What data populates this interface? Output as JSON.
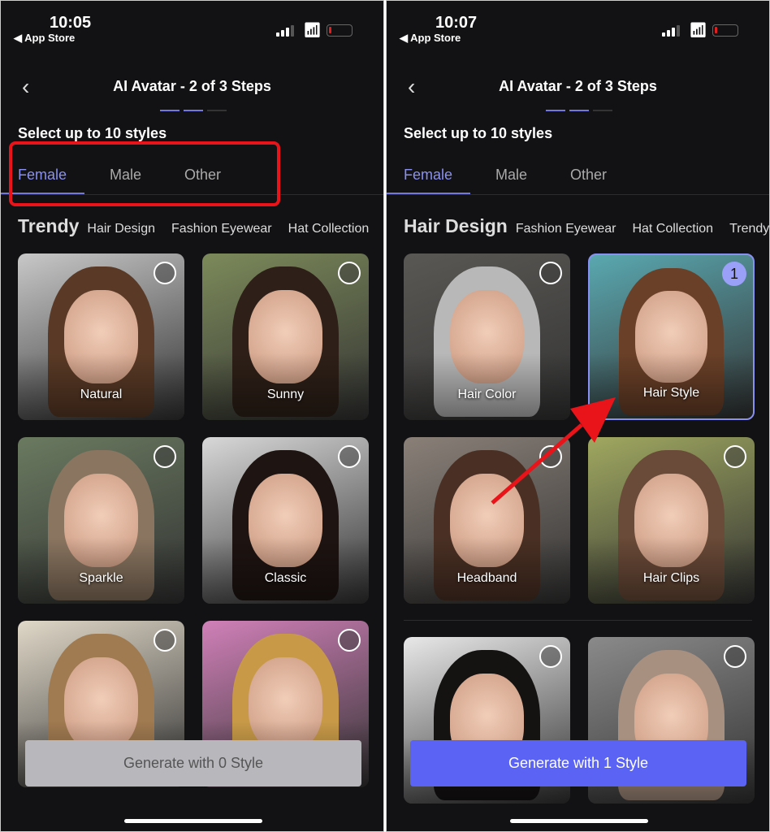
{
  "colors": {
    "accent": "#7378e0",
    "button_active": "#5b63f5",
    "annotation": "#e8141a"
  },
  "screens": [
    {
      "time": "10:05",
      "back_app": "◀ App Store",
      "title": "AI Avatar - 2 of 3 Steps",
      "subtitle": "Select up to 10 styles",
      "tabs": [
        "Female",
        "Male",
        "Other"
      ],
      "active_tab": 0,
      "categories": [
        "Trendy",
        "Hair Design",
        "Fashion Eyewear",
        "Hat Collection"
      ],
      "cards": [
        {
          "label": "Natural",
          "hair": "#5a3a26",
          "bg": "#c8c8c8"
        },
        {
          "label": "Sunny",
          "hair": "#2e2018",
          "bg": "#7c8a5a"
        },
        {
          "label": "Sparkle",
          "hair": "#8a7560",
          "bg": "#6a7a60"
        },
        {
          "label": "Classic",
          "hair": "#1e1412",
          "bg": "#d8d8d8"
        },
        {
          "label": "",
          "hair": "#a07a50",
          "bg": "#e0d8c8"
        },
        {
          "label": "",
          "hair": "#c89a48",
          "bg": "#d080b8"
        }
      ],
      "generate": "Generate with 0 Style",
      "steps_done": 2,
      "steps_total": 3
    },
    {
      "time": "10:07",
      "back_app": "◀ App Store",
      "title": "AI Avatar - 2 of 3 Steps",
      "subtitle": "Select up to 10 styles",
      "tabs": [
        "Female",
        "Male",
        "Other"
      ],
      "active_tab": 0,
      "categories": [
        "Hair Design",
        "Fashion Eyewear",
        "Hat Collection",
        "Trendy"
      ],
      "cards": [
        {
          "label": "Hair Color",
          "hair": "#b8b8b8",
          "bg": "#5a5854"
        },
        {
          "label": "Hair Style",
          "hair": "#6a4028",
          "bg": "#5aa8b0",
          "selected": "1"
        },
        {
          "label": "Headband",
          "hair": "#4a3024",
          "bg": "#8a8078"
        },
        {
          "label": "Hair Clips",
          "hair": "#6a4a38",
          "bg": "#a0a860"
        },
        {
          "label": "",
          "hair": "#151212",
          "bg": "#e8e8e8"
        },
        {
          "label": "",
          "hair": "#a89080",
          "bg": "#8a8a8a"
        }
      ],
      "generate": "Generate with 1 Style",
      "steps_done": 2,
      "steps_total": 3
    }
  ]
}
